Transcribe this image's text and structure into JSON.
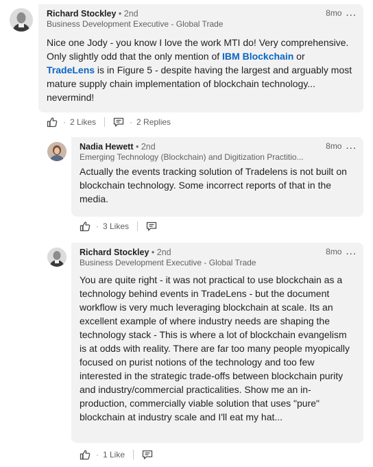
{
  "comments": [
    {
      "name": "Richard Stockley",
      "degree": "• 2nd",
      "headline": "Business Development Executive - Global Trade",
      "time": "8mo",
      "more": "...",
      "body_parts": [
        "Nice one Jody - you know I love the work MTI do! Very comprehensive. Only slightly odd that the only mention of ",
        "IBM Blockchain",
        " or ",
        "TradeLens",
        " is in Figure 5 - despite having the largest and arguably most mature supply chain implementation of blockchain technology... nevermind!"
      ],
      "likes": "2 Likes",
      "dot": "·",
      "replies": "2 Replies"
    },
    {
      "name": "Nadia Hewett",
      "degree": "• 2nd",
      "headline": "Emerging Technology (Blockchain) and Digitization Practitio...",
      "time": "8mo",
      "more": "...",
      "body": "Actually the events tracking solution of Tradelens is not built on blockchain technology. Some incorrect reports of that in the media.",
      "likes": "3 Likes",
      "dot": "·"
    },
    {
      "name": "Richard Stockley",
      "degree": "• 2nd",
      "headline": "Business Development Executive - Global Trade",
      "time": "8mo",
      "more": "...",
      "body": "You are quite right - it was not practical to use blockchain as a technology behind events in TradeLens - but the document workflow is very much leveraging blockchain at scale. Its an excellent example of where industry needs are shaping the technology stack - This is where a lot of blockchain evangelism is at odds with reality. There are far too many people myopically focused on purist notions of the technology and too few interested in the strategic trade-offs between blockchain purity and industry/commercial practicalities. Show me an in-production, commercially viable solution that uses \"pure\" blockchain at industry scale and I'll eat my hat...",
      "likes": "1 Like",
      "dot": "·"
    }
  ],
  "icons": {
    "like": "thumbs-up-icon",
    "reply": "reply-icon",
    "more": "more-icon"
  },
  "colors": {
    "link": "#0a66c2",
    "bubble": "#f2f2f2"
  }
}
